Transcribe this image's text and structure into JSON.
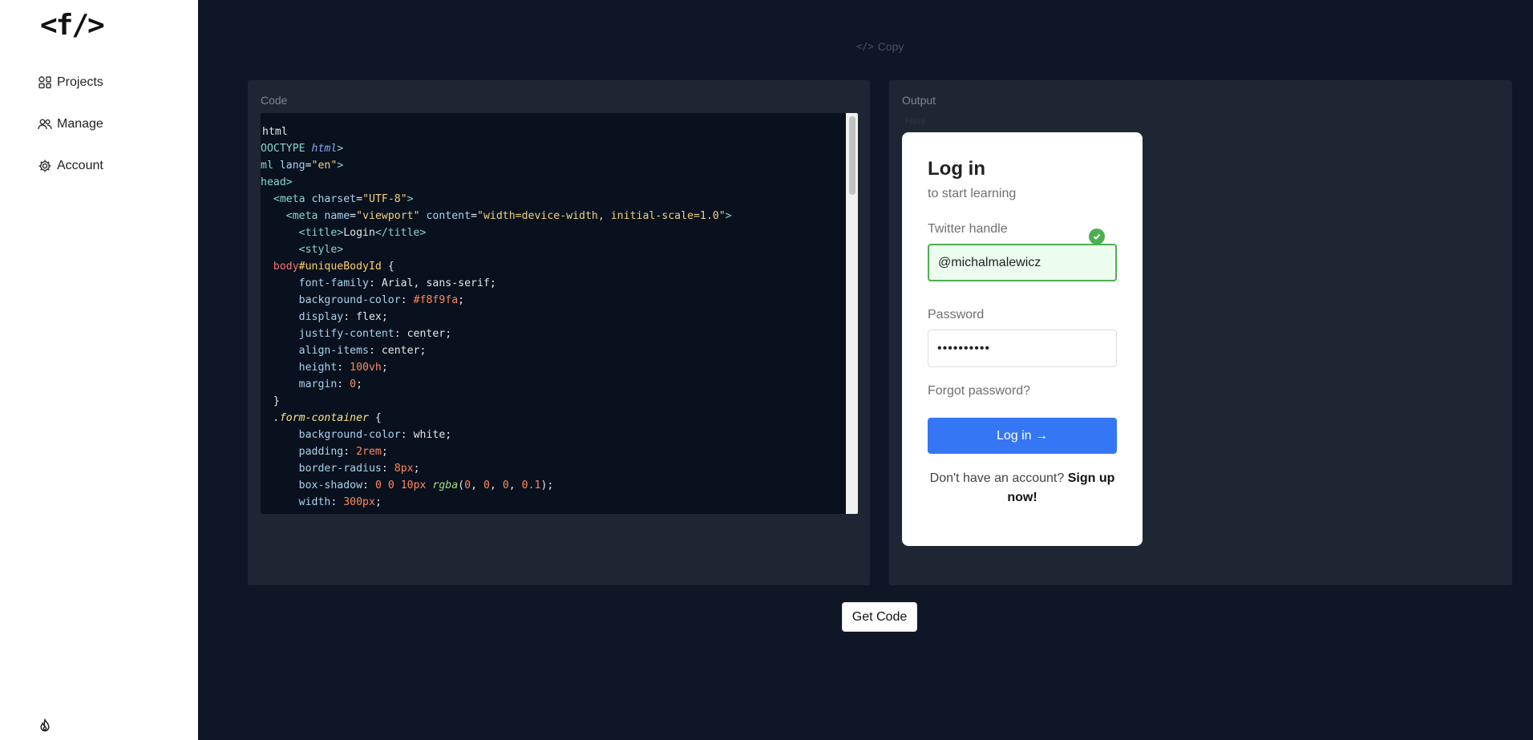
{
  "sidebar": {
    "logo": "<f/>",
    "items": [
      {
        "label": "Projects",
        "icon": "projects-icon"
      },
      {
        "label": "Manage",
        "icon": "users-icon"
      },
      {
        "label": "Account",
        "icon": "gear-icon"
      }
    ],
    "footer_icon": "flame-icon"
  },
  "toolbar": {
    "copy_label": "Copy"
  },
  "code_panel": {
    "title": "Code",
    "lines": [
      [
        [
          "t-plain",
          "html"
        ]
      ],
      [
        [
          "t-tag",
          "OOCTYPE "
        ],
        [
          "t-kw",
          "html"
        ],
        [
          "t-tag",
          ">"
        ]
      ],
      [
        [
          "t-tag",
          "ml "
        ],
        [
          "t-attr",
          "lang"
        ],
        [
          "t-plain",
          "="
        ],
        [
          "t-str",
          "\"en\""
        ],
        [
          "t-tag",
          ">"
        ]
      ],
      [
        [
          "t-tag",
          "head>"
        ]
      ],
      [
        [
          "t-plain",
          "  "
        ],
        [
          "t-tag",
          "<meta "
        ],
        [
          "t-attr",
          "charset"
        ],
        [
          "t-plain",
          "="
        ],
        [
          "t-str",
          "\"UTF-8\""
        ],
        [
          "t-tag",
          ">"
        ]
      ],
      [
        [
          "t-plain",
          "    "
        ],
        [
          "t-tag",
          "<meta "
        ],
        [
          "t-attr",
          "name"
        ],
        [
          "t-plain",
          "="
        ],
        [
          "t-str",
          "\"viewport\""
        ],
        [
          "t-plain",
          " "
        ],
        [
          "t-attr",
          "content"
        ],
        [
          "t-plain",
          "="
        ],
        [
          "t-str",
          "\"width=device-width, initial-scale=1.0\""
        ],
        [
          "t-tag",
          ">"
        ]
      ],
      [
        [
          "t-plain",
          "      "
        ],
        [
          "t-tag",
          "<title>"
        ],
        [
          "t-plain",
          "Login"
        ],
        [
          "t-tag",
          "</title>"
        ]
      ],
      [
        [
          "t-plain",
          "      "
        ],
        [
          "t-tag",
          "<style>"
        ]
      ],
      [
        [
          "t-plain",
          "  "
        ],
        [
          "t-sel",
          "body"
        ],
        [
          "t-id",
          "#uniqueBodyId"
        ],
        [
          "t-plain",
          " {"
        ]
      ],
      [
        [
          "t-plain",
          "      "
        ],
        [
          "t-prop",
          "font-family"
        ],
        [
          "t-plain",
          ": Arial, sans-serif;"
        ]
      ],
      [
        [
          "t-plain",
          "      "
        ],
        [
          "t-prop",
          "background-color"
        ],
        [
          "t-plain",
          ": "
        ],
        [
          "t-hex",
          "#f8f9fa"
        ],
        [
          "t-plain",
          ";"
        ]
      ],
      [
        [
          "t-plain",
          "      "
        ],
        [
          "t-prop",
          "display"
        ],
        [
          "t-plain",
          ": flex;"
        ]
      ],
      [
        [
          "t-plain",
          "      "
        ],
        [
          "t-prop",
          "justify-content"
        ],
        [
          "t-plain",
          ": center;"
        ]
      ],
      [
        [
          "t-plain",
          "      "
        ],
        [
          "t-prop",
          "align-items"
        ],
        [
          "t-plain",
          ": center;"
        ]
      ],
      [
        [
          "t-plain",
          "      "
        ],
        [
          "t-prop",
          "height"
        ],
        [
          "t-plain",
          ": "
        ],
        [
          "t-num",
          "100vh"
        ],
        [
          "t-plain",
          ";"
        ]
      ],
      [
        [
          "t-plain",
          "      "
        ],
        [
          "t-prop",
          "margin"
        ],
        [
          "t-plain",
          ": "
        ],
        [
          "t-num",
          "0"
        ],
        [
          "t-plain",
          ";"
        ]
      ],
      [
        [
          "t-plain",
          "  }"
        ]
      ],
      [
        [
          "t-plain",
          "  "
        ],
        [
          "t-cls",
          ".form-container"
        ],
        [
          "t-plain",
          " {"
        ]
      ],
      [
        [
          "t-plain",
          "      "
        ],
        [
          "t-prop",
          "background-color"
        ],
        [
          "t-plain",
          ": white;"
        ]
      ],
      [
        [
          "t-plain",
          "      "
        ],
        [
          "t-prop",
          "padding"
        ],
        [
          "t-plain",
          ": "
        ],
        [
          "t-num",
          "2rem"
        ],
        [
          "t-plain",
          ";"
        ]
      ],
      [
        [
          "t-plain",
          "      "
        ],
        [
          "t-prop",
          "border-radius"
        ],
        [
          "t-plain",
          ": "
        ],
        [
          "t-num",
          "8px"
        ],
        [
          "t-plain",
          ";"
        ]
      ],
      [
        [
          "t-plain",
          "      "
        ],
        [
          "t-prop",
          "box-shadow"
        ],
        [
          "t-plain",
          ": "
        ],
        [
          "t-num",
          "0 0 10px "
        ],
        [
          "t-fn",
          "rgba"
        ],
        [
          "t-plain",
          "("
        ],
        [
          "t-num",
          "0"
        ],
        [
          "t-plain",
          ", "
        ],
        [
          "t-num",
          "0"
        ],
        [
          "t-plain",
          ", "
        ],
        [
          "t-num",
          "0"
        ],
        [
          "t-plain",
          ", "
        ],
        [
          "t-num",
          "0.1"
        ],
        [
          "t-plain",
          ");"
        ]
      ],
      [
        [
          "t-plain",
          "      "
        ],
        [
          "t-prop",
          "width"
        ],
        [
          "t-plain",
          ": "
        ],
        [
          "t-num",
          "300px"
        ],
        [
          "t-plain",
          ";"
        ]
      ]
    ]
  },
  "output_panel": {
    "title": "Output",
    "faint_text": "Html",
    "login": {
      "title": "Log in",
      "subtitle": "to start learning",
      "twitter_label": "Twitter handle",
      "twitter_value": "@michalmalewicz",
      "password_label": "Password",
      "password_value": "••••••••••",
      "forgot": "Forgot password?",
      "button": "Log in →",
      "signup_prefix": "Don't have an account? ",
      "signup_link": "Sign up now!"
    }
  },
  "actions": {
    "get_code": "Get Code"
  },
  "colors": {
    "accent": "#3576f5",
    "success": "#4caf50",
    "bg": "#0f1625",
    "panel": "#1f2633"
  }
}
